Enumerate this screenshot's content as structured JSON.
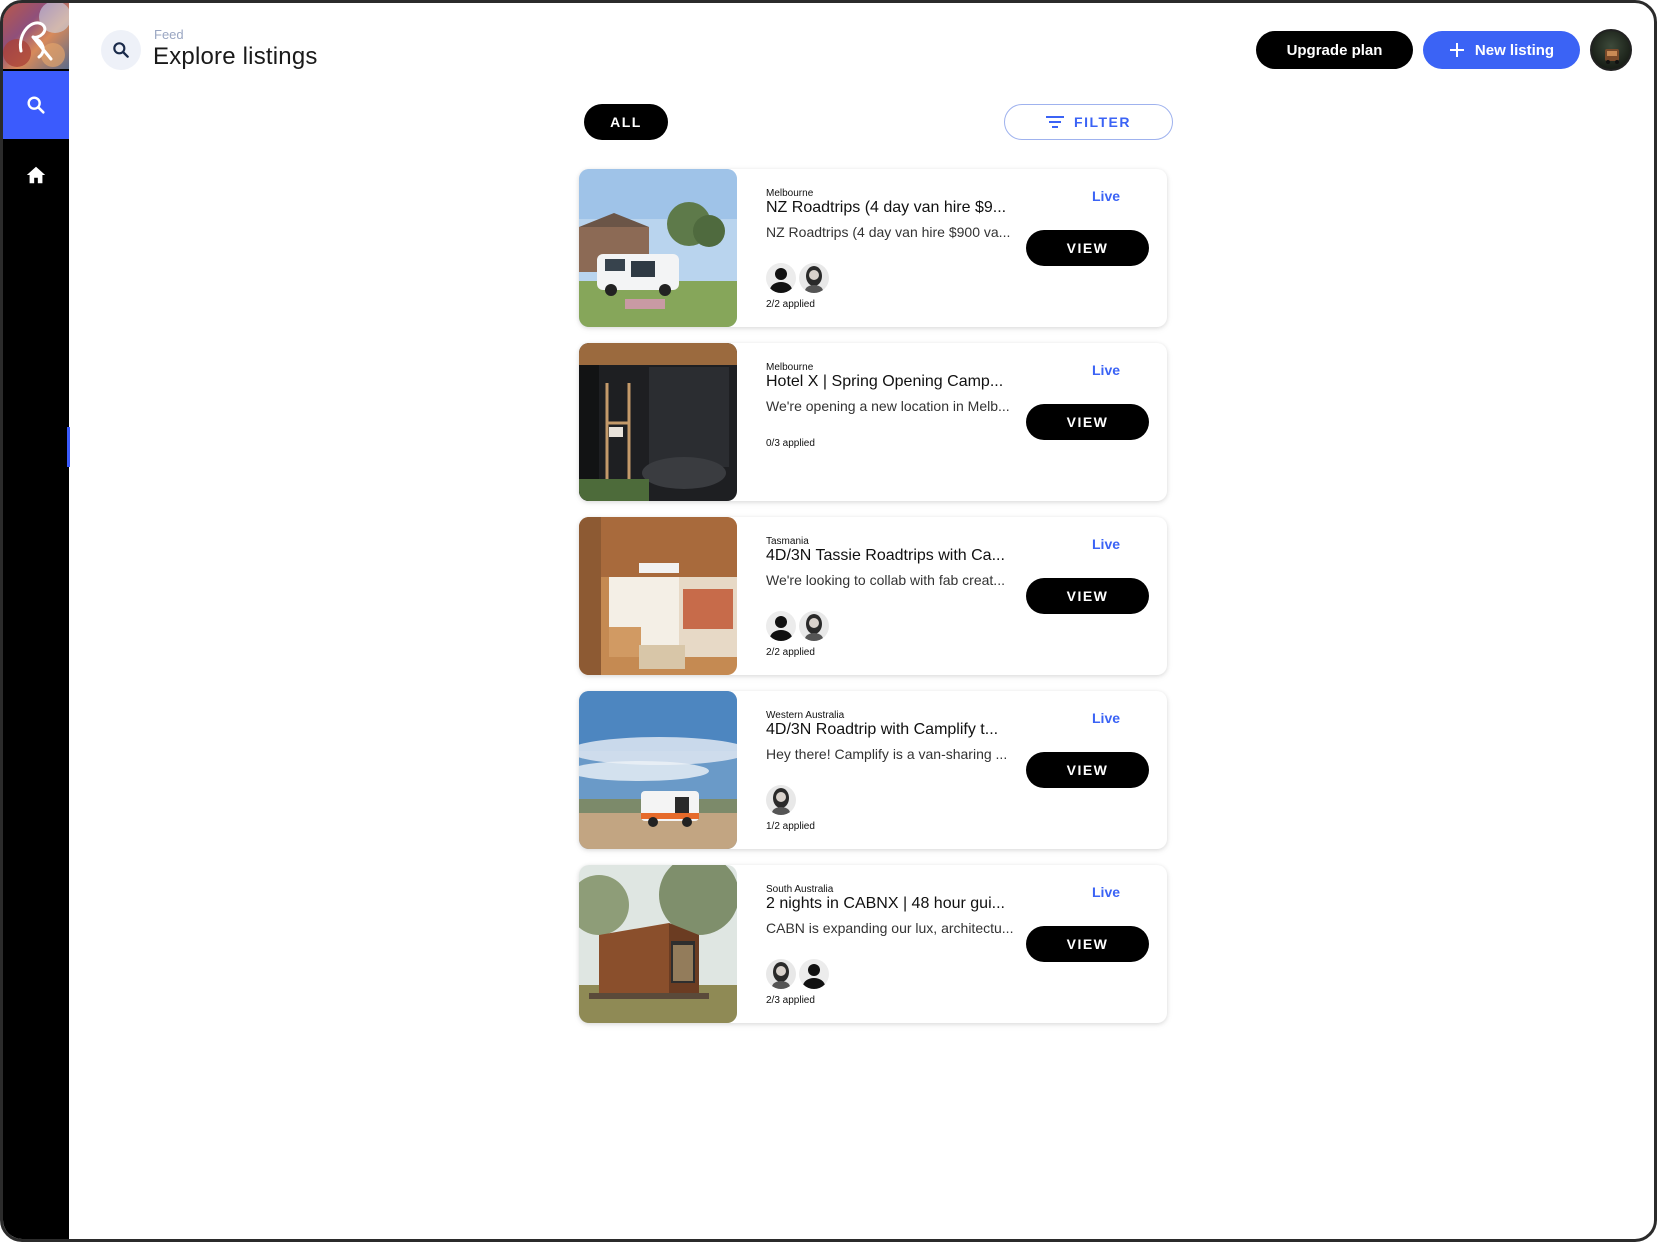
{
  "header": {
    "breadcrumb": "Feed",
    "title": "Explore listings",
    "upgrade_label": "Upgrade plan",
    "new_listing_label": "New listing"
  },
  "sidebar": {
    "items": [
      {
        "icon": "search-icon",
        "active": true
      },
      {
        "icon": "home-icon",
        "active": false
      }
    ]
  },
  "filters": {
    "all_label": "ALL",
    "filter_label": "FILTER"
  },
  "listings": [
    {
      "location": "Melbourne",
      "title": "NZ Roadtrips (4 day van hire $9...",
      "description": "NZ Roadtrips (4 day van hire $900 va...",
      "applied": "2/2 applied",
      "status": "Live",
      "view_label": "VIEW"
    },
    {
      "location": "Melbourne",
      "title": "Hotel X | Spring Opening Camp...",
      "description": "We're opening a new location in Melb...",
      "applied": "0/3 applied",
      "status": "Live",
      "view_label": "VIEW"
    },
    {
      "location": "Tasmania",
      "title": "4D/3N Tassie Roadtrips with Ca...",
      "description": "We're looking to collab with fab creat...",
      "applied": "2/2 applied",
      "status": "Live",
      "view_label": "VIEW"
    },
    {
      "location": "Western Australia",
      "title": "4D/3N Roadtrip with Camplify t...",
      "description": "Hey there! Camplify is a van-sharing ...",
      "applied": "1/2 applied",
      "status": "Live",
      "view_label": "VIEW"
    },
    {
      "location": "South Australia",
      "title": "2 nights in CABNX | 48 hour gui...",
      "description": "CABN is expanding our lux, architectu...",
      "applied": "2/3 applied",
      "status": "Live",
      "view_label": "VIEW"
    }
  ],
  "colors": {
    "accent": "#3b63f5",
    "sidebar_bg": "#000000",
    "sidebar_active": "#3b5bfd"
  }
}
